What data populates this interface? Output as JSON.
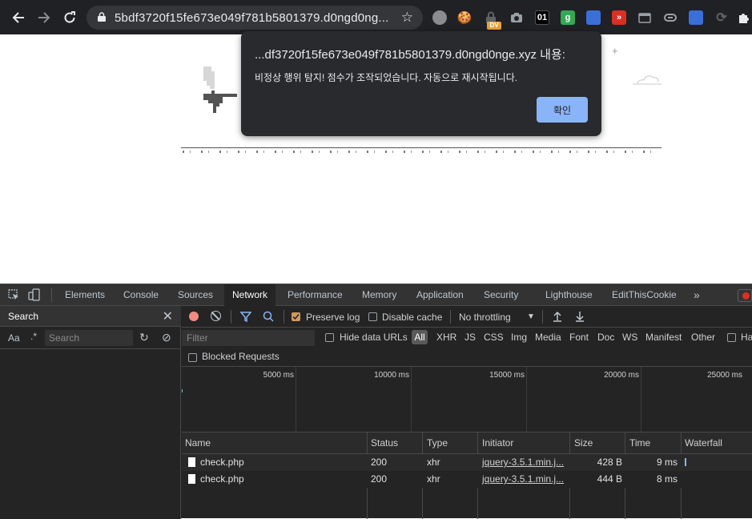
{
  "browser": {
    "url": "5bdf3720f15fe673e049f781b5801379.d0ngd0ng...",
    "extension_badge": "DV",
    "extension_01": "01"
  },
  "dialog": {
    "title": "...df3720f15fe673e049f781b5801379.d0ngd0nge.xyz 내용:",
    "message": "비정상 행위 탐지! 점수가 조작되었습니다. 자동으로 재시작됩니다.",
    "ok_label": "확인"
  },
  "devtools": {
    "tabs": [
      "Elements",
      "Console",
      "Sources",
      "Network",
      "Performance",
      "Memory",
      "Application",
      "Security",
      "Lighthouse",
      "EditThisCookie"
    ],
    "more": "»",
    "active_tab": "Network",
    "search_panel": {
      "title": "Search",
      "aa": "Aa",
      "regex": ".*",
      "placeholder": "Search"
    },
    "toolbar": {
      "preserve_log": "Preserve log",
      "disable_cache": "Disable cache",
      "throttling": "No throttling"
    },
    "filter": {
      "placeholder": "Filter",
      "hide_data_urls": "Hide data URLs",
      "types": [
        "All",
        "XHR",
        "JS",
        "CSS",
        "Img",
        "Media",
        "Font",
        "Doc",
        "WS",
        "Manifest",
        "Other"
      ],
      "truncated": "Ha",
      "blocked_requests": "Blocked Requests"
    },
    "timeline_labels": [
      "5000 ms",
      "10000 ms",
      "15000 ms",
      "20000 ms",
      "25000 ms"
    ],
    "columns": [
      "Name",
      "Status",
      "Type",
      "Initiator",
      "Size",
      "Time",
      "Waterfall"
    ],
    "rows": [
      {
        "name": "check.php",
        "status": "200",
        "type": "xhr",
        "initiator": "jquery-3.5.1.min.j...",
        "size": "428 B",
        "time": "9 ms"
      },
      {
        "name": "check.php",
        "status": "200",
        "type": "xhr",
        "initiator": "jquery-3.5.1.min.j...",
        "size": "444 B",
        "time": "8 ms"
      }
    ]
  },
  "colors": {
    "accent_button": "#8ab4f8",
    "record": "#f28b82",
    "filter_active": "#8ab4f8"
  }
}
